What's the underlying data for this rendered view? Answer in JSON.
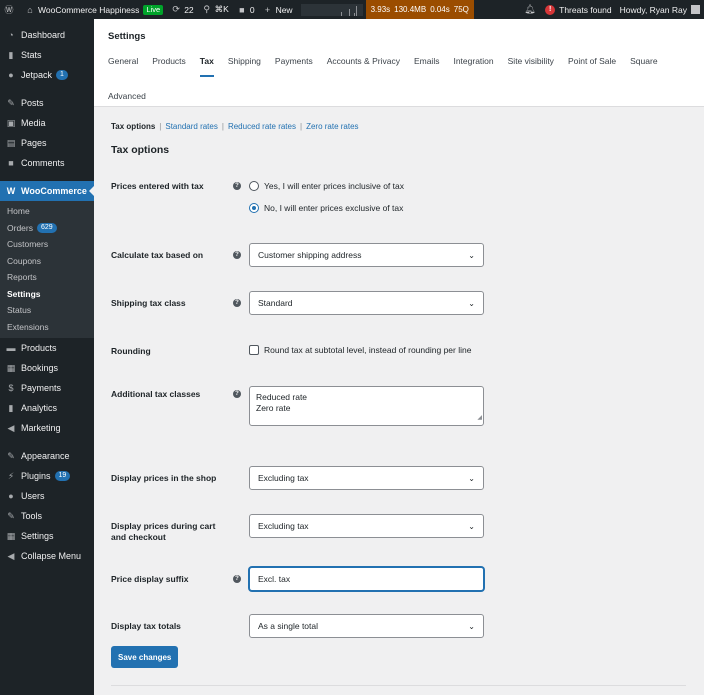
{
  "adminbar": {
    "site_name": "WooCommerce Happiness",
    "live_badge": "Live",
    "updates_count": "22",
    "search_shortcut": "⌘K",
    "comments_count": "0",
    "new_label": "New",
    "perf": {
      "time": "3.93s",
      "memory": "130.4MB",
      "db_time": "0.04s",
      "queries": "75Q"
    },
    "threats_label": "Threats found",
    "howdy": "Howdy, Ryan Ray",
    "icons": [
      "wordpress-icon",
      "home-icon",
      "updates-icon",
      "search-icon",
      "comment-icon",
      "plus-icon",
      "bell-icon",
      "alert-icon"
    ]
  },
  "sidebar": {
    "top_items": [
      {
        "label": "Dashboard",
        "icon": "dashboard-icon"
      },
      {
        "label": "Stats",
        "icon": "stats-icon"
      },
      {
        "label": "Jetpack",
        "icon": "jetpack-icon",
        "badge": "1"
      },
      {
        "label": "Posts",
        "icon": "pin-icon"
      },
      {
        "label": "Media",
        "icon": "media-icon"
      },
      {
        "label": "Pages",
        "icon": "pages-icon"
      },
      {
        "label": "Comments",
        "icon": "comments-icon"
      }
    ],
    "woocommerce_label": "WooCommerce",
    "submenu": [
      {
        "label": "Home"
      },
      {
        "label": "Orders",
        "badge": "629"
      },
      {
        "label": "Customers"
      },
      {
        "label": "Coupons"
      },
      {
        "label": "Reports"
      },
      {
        "label": "Settings"
      },
      {
        "label": "Status"
      },
      {
        "label": "Extensions"
      }
    ],
    "bottom_items": [
      {
        "label": "Products",
        "icon": "products-icon"
      },
      {
        "label": "Bookings",
        "icon": "calendar-icon"
      },
      {
        "label": "Payments",
        "icon": "dollar-icon"
      },
      {
        "label": "Analytics",
        "icon": "analytics-icon"
      },
      {
        "label": "Marketing",
        "icon": "megaphone-icon"
      },
      {
        "label": "Appearance",
        "icon": "brush-icon"
      },
      {
        "label": "Plugins",
        "icon": "plugin-icon",
        "badge": "19"
      },
      {
        "label": "Users",
        "icon": "user-icon"
      },
      {
        "label": "Tools",
        "icon": "wrench-icon"
      },
      {
        "label": "Settings",
        "icon": "settings-icon"
      },
      {
        "label": "Collapse Menu",
        "icon": "collapse-icon"
      }
    ]
  },
  "header": {
    "title": "Settings",
    "tabs": [
      "General",
      "Products",
      "Tax",
      "Shipping",
      "Payments",
      "Accounts & Privacy",
      "Emails",
      "Integration",
      "Site visibility",
      "Point of Sale",
      "Square"
    ],
    "active_tab": "Tax",
    "tab_row2": "Advanced"
  },
  "subnav": {
    "current": "Tax options",
    "links": [
      "Standard rates",
      "Reduced rate rates",
      "Zero rate rates"
    ]
  },
  "section_title": "Tax options",
  "fields": {
    "prices_entered_with_tax": {
      "label": "Prices entered with tax",
      "options": [
        "Yes, I will enter prices inclusive of tax",
        "No, I will enter prices exclusive of tax"
      ],
      "selected_index": 1
    },
    "calculate_tax_based_on": {
      "label": "Calculate tax based on",
      "value": "Customer shipping address"
    },
    "shipping_tax_class": {
      "label": "Shipping tax class",
      "value": "Standard"
    },
    "rounding": {
      "label": "Rounding",
      "checkbox_label": "Round tax at subtotal level, instead of rounding per line",
      "checked": false
    },
    "additional_tax_classes": {
      "label": "Additional tax classes",
      "line1": "Reduced rate",
      "line2": "Zero rate"
    },
    "display_prices_shop": {
      "label": "Display prices in the shop",
      "value": "Excluding tax"
    },
    "display_prices_cart_line1": "Display prices during cart",
    "display_prices_cart_line2": "and checkout",
    "display_prices_cart_value": "Excluding tax",
    "price_display_suffix": {
      "label": "Price display suffix",
      "value": "Excl. tax"
    },
    "display_tax_totals": {
      "label": "Display tax totals",
      "value": "As a single total"
    }
  },
  "save_button": "Save changes",
  "colors": {
    "accent": "#2271b1",
    "adminbar": "#1d2327",
    "perf": "#9b4d00",
    "live": "#00a32a",
    "threat": "#d63638"
  }
}
